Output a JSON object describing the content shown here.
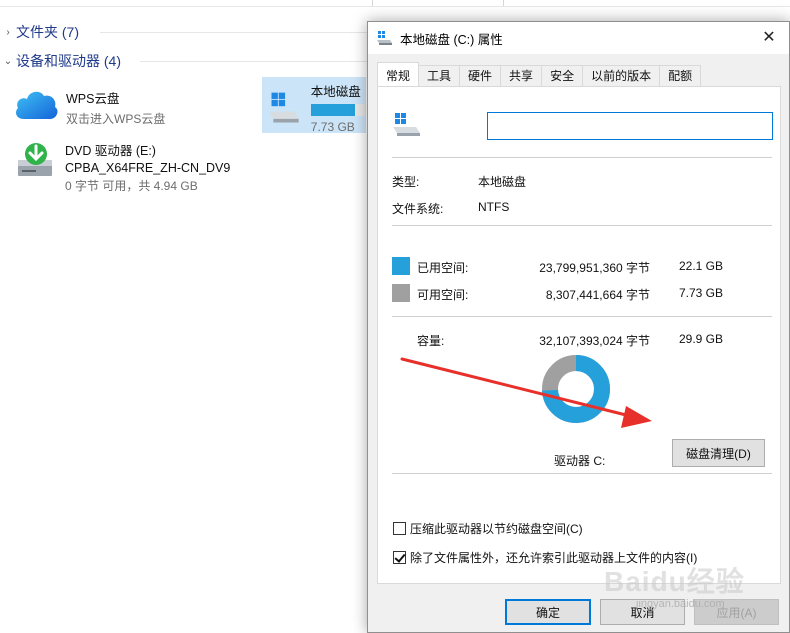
{
  "explorer": {
    "groups": [
      {
        "label": "文件夹 (7)"
      },
      {
        "label": "设备和驱动器 (4)"
      }
    ],
    "wps": {
      "title": "WPS云盘",
      "subtitle": "双击进入WPS云盘"
    },
    "dvd": {
      "title": "DVD 驱动器 (E:)",
      "volume": "CPBA_X64FRE_ZH-CN_DV9",
      "space": "0 字节 可用，共 4.94 GB"
    },
    "local_disk": {
      "title": "本地磁盘",
      "space": "7.73 GB",
      "used_fraction": 0.74
    }
  },
  "dialog": {
    "title": "本地磁盘 (C:) 属性",
    "close_symbol": "✕",
    "tabs": [
      "常规",
      "工具",
      "硬件",
      "共享",
      "安全",
      "以前的版本",
      "配额"
    ],
    "active_tab": 0,
    "name_value": "",
    "type_label": "类型:",
    "type_value": "本地磁盘",
    "fs_label": "文件系统:",
    "fs_value": "NTFS",
    "used": {
      "label": "已用空间:",
      "bytes": "23,799,951,360 字节",
      "size": "22.1 GB",
      "color": "#26a0da"
    },
    "free": {
      "label": "可用空间:",
      "bytes": "8,307,441,664 字节",
      "size": "7.73 GB",
      "color": "#a0a0a0"
    },
    "capacity": {
      "label": "容量:",
      "bytes": "32,107,393,024 字节",
      "size": "29.9 GB"
    },
    "drive_label": "驱动器 C:",
    "cleanup_button": "磁盘清理(D)",
    "compress_label": "压缩此驱动器以节约磁盘空间(C)",
    "compress_checked": false,
    "index_label": "除了文件属性外，还允许索引此驱动器上文件的内容(I)",
    "index_checked": true,
    "ok_button": "确定",
    "cancel_button": "取消",
    "apply_button": "应用(A)",
    "used_fraction": 0.741
  },
  "watermark": {
    "text": "Baidu经验",
    "url": "jingyan.baidu.com"
  },
  "colors": {
    "accent": "#0078d7",
    "arrow": "#e8302a"
  }
}
